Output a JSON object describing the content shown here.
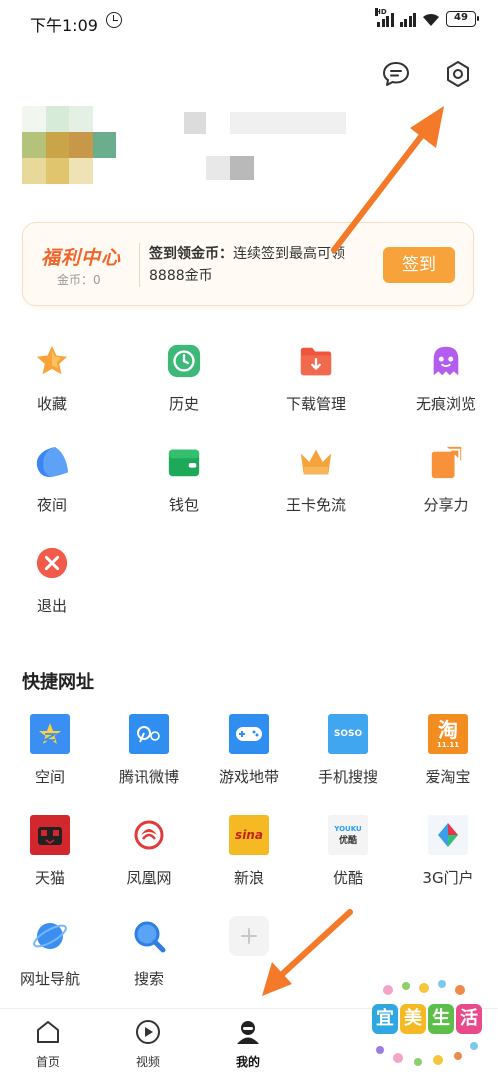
{
  "status_bar": {
    "time": "下午1:09",
    "battery": "49"
  },
  "welfare": {
    "title": "福利中心",
    "coins_label": "金币：0",
    "desc_bold": "签到领金币：",
    "desc_text": "连续签到最高可领8888金币",
    "button": "签到"
  },
  "features": [
    {
      "label": "收藏",
      "icon": "star-icon"
    },
    {
      "label": "历史",
      "icon": "clock-icon"
    },
    {
      "label": "下载管理",
      "icon": "download-folder-icon"
    },
    {
      "label": "无痕浏览",
      "icon": "ghost-icon"
    },
    {
      "label": "夜间",
      "icon": "moon-icon"
    },
    {
      "label": "钱包",
      "icon": "wallet-icon"
    },
    {
      "label": "王卡免流",
      "icon": "crown-icon"
    },
    {
      "label": "分享力",
      "icon": "share-icon"
    },
    {
      "label": "退出",
      "icon": "exit-icon"
    }
  ],
  "shortcuts_title": "快捷网址",
  "shortcuts": [
    {
      "label": "空间",
      "color": "#3b8ff3"
    },
    {
      "label": "腾讯微博",
      "color": "#2f8ef0"
    },
    {
      "label": "游戏地带",
      "color": "#2f8ef0"
    },
    {
      "label": "手机搜搜",
      "color": "#3fa6ef"
    },
    {
      "label": "爱淘宝",
      "color": "#f38d1f"
    },
    {
      "label": "天猫",
      "color": "#d2272d"
    },
    {
      "label": "凤凰网",
      "color": "#e23a3a"
    },
    {
      "label": "新浪",
      "color": "#f5b923"
    },
    {
      "label": "优酷",
      "color": "#f4f4f4"
    },
    {
      "label": "3G门户",
      "color": "#3a9ee8"
    },
    {
      "label": "网址导航",
      "color": "#3b8ff3"
    },
    {
      "label": "搜索",
      "color": "#2e7fe4"
    }
  ],
  "site_logos": {
    "soso": "SOSO",
    "taobao": "淘",
    "taobao_sub": "11.11",
    "sina": "sina",
    "youku": "YOUKU",
    "youku_sub": "优酷"
  },
  "bottom_nav": [
    {
      "label": "首页",
      "icon": "home-icon"
    },
    {
      "label": "视频",
      "icon": "play-icon"
    },
    {
      "label": "我的",
      "icon": "user-icon"
    }
  ],
  "watermark": [
    "宜",
    "美",
    "生",
    "活"
  ],
  "colors": {
    "accent": "#f7a23b",
    "arrow": "#f47a2a",
    "welfare_title": "#f2652a"
  }
}
